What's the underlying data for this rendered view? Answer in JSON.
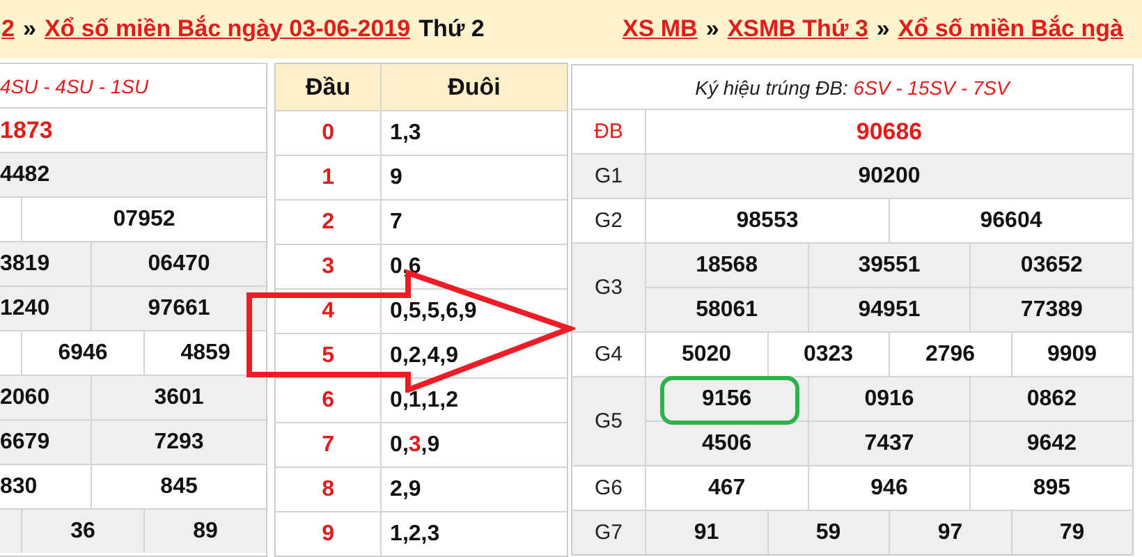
{
  "left": {
    "breadcrumb": [
      {
        "text": "2",
        "kind": "link"
      },
      {
        "text": "»",
        "kind": "sep"
      },
      {
        "text": "Xổ số miền Bắc ngày 03-06-2019",
        "kind": "link"
      },
      {
        "text": "Thứ 2",
        "kind": "plain"
      }
    ],
    "results": {
      "code": "4SU - 4SU - 1SU",
      "rows": [
        {
          "kind": "full",
          "shaded": false,
          "hot": true,
          "cells": [
            "1873"
          ]
        },
        {
          "kind": "full",
          "shaded": true,
          "hot": false,
          "cells": [
            "4482"
          ]
        },
        {
          "kind": "stub",
          "shaded": false,
          "hot": false,
          "cells": [
            "07952"
          ]
        },
        {
          "kind": "split",
          "shaded": true,
          "hot": false,
          "cells": [
            "3819",
            "06470"
          ]
        },
        {
          "kind": "split",
          "shaded": true,
          "hot": false,
          "cells": [
            "1240",
            "97661"
          ]
        },
        {
          "kind": "stub",
          "shaded": false,
          "hot": false,
          "cells": [
            "6946",
            "4859"
          ]
        },
        {
          "kind": "split",
          "shaded": true,
          "hot": false,
          "cells": [
            "2060",
            "3601"
          ]
        },
        {
          "kind": "split",
          "shaded": true,
          "hot": false,
          "cells": [
            "6679",
            "7293"
          ]
        },
        {
          "kind": "split",
          "shaded": false,
          "hot": false,
          "cells": [
            "830",
            "845"
          ]
        },
        {
          "kind": "stub",
          "shaded": true,
          "hot": false,
          "cells": [
            "36",
            "89"
          ]
        }
      ]
    },
    "head_tail": {
      "columns": [
        "Đầu",
        "Đuôi"
      ],
      "rows": [
        {
          "head": "0",
          "tail": [
            {
              "text": "1,3",
              "hot": false
            }
          ]
        },
        {
          "head": "1",
          "tail": [
            {
              "text": "9",
              "hot": false
            }
          ]
        },
        {
          "head": "2",
          "tail": [
            {
              "text": "7",
              "hot": false
            }
          ]
        },
        {
          "head": "3",
          "tail": [
            {
              "text": "0,6",
              "hot": false
            }
          ]
        },
        {
          "head": "4",
          "tail": [
            {
              "text": "0,5,5,6,9",
              "hot": false
            }
          ]
        },
        {
          "head": "5",
          "tail": [
            {
              "text": "0,2,4,9",
              "hot": false
            }
          ]
        },
        {
          "head": "6",
          "tail": [
            {
              "text": "0,1,1,2",
              "hot": false
            }
          ]
        },
        {
          "head": "7",
          "tail": [
            {
              "text": "0,",
              "hot": false
            },
            {
              "text": "3",
              "hot": true
            },
            {
              "text": ",9",
              "hot": false
            }
          ]
        },
        {
          "head": "8",
          "tail": [
            {
              "text": "2,9",
              "hot": false
            }
          ]
        },
        {
          "head": "9",
          "tail": [
            {
              "text": "1,2,3",
              "hot": false
            }
          ]
        }
      ]
    }
  },
  "right": {
    "breadcrumb": [
      {
        "text": "XS MB",
        "kind": "link"
      },
      {
        "text": "»",
        "kind": "sep"
      },
      {
        "text": "XSMB Thứ 3",
        "kind": "link"
      },
      {
        "text": "»",
        "kind": "sep"
      },
      {
        "text": "Xổ số miền Bắc ngà",
        "kind": "link"
      }
    ],
    "results": {
      "code_label": "Ký hiệu trúng ĐB:",
      "code": "6SV - 15SV - 7SV",
      "rows": [
        {
          "label": "ĐB",
          "hot": true,
          "shaded": false,
          "lines": [
            [
              {
                "text": "90686",
                "circled": false
              }
            ]
          ]
        },
        {
          "label": "G1",
          "hot": false,
          "shaded": true,
          "lines": [
            [
              {
                "text": "90200",
                "circled": false
              }
            ]
          ]
        },
        {
          "label": "G2",
          "hot": false,
          "shaded": false,
          "lines": [
            [
              {
                "text": "98553",
                "circled": false
              },
              {
                "text": "96604",
                "circled": false
              }
            ]
          ]
        },
        {
          "label": "G3",
          "hot": false,
          "shaded": true,
          "lines": [
            [
              {
                "text": "18568",
                "circled": false
              },
              {
                "text": "39551",
                "circled": false
              },
              {
                "text": "03652",
                "circled": false
              }
            ],
            [
              {
                "text": "58061",
                "circled": false
              },
              {
                "text": "94951",
                "circled": false
              },
              {
                "text": "77389",
                "circled": false
              }
            ]
          ]
        },
        {
          "label": "G4",
          "hot": false,
          "shaded": false,
          "lines": [
            [
              {
                "text": "5020",
                "circled": false
              },
              {
                "text": "0323",
                "circled": false
              },
              {
                "text": "2796",
                "circled": false
              },
              {
                "text": "9909",
                "circled": false
              }
            ]
          ]
        },
        {
          "label": "G5",
          "hot": false,
          "shaded": true,
          "lines": [
            [
              {
                "text": "9156",
                "circled": true
              },
              {
                "text": "0916",
                "circled": false
              },
              {
                "text": "0862",
                "circled": false
              }
            ],
            [
              {
                "text": "4506",
                "circled": false
              },
              {
                "text": "7437",
                "circled": false
              },
              {
                "text": "9642",
                "circled": false
              }
            ]
          ]
        },
        {
          "label": "G6",
          "hot": false,
          "shaded": false,
          "lines": [
            [
              {
                "text": "467",
                "circled": false
              },
              {
                "text": "946",
                "circled": false
              },
              {
                "text": "895",
                "circled": false
              }
            ]
          ]
        },
        {
          "label": "G7",
          "hot": false,
          "shaded": true,
          "lines": [
            [
              {
                "text": "91",
                "circled": false
              },
              {
                "text": "59",
                "circled": false
              },
              {
                "text": "97",
                "circled": false
              },
              {
                "text": "79",
                "circled": false
              }
            ]
          ]
        }
      ]
    }
  },
  "annotation": {
    "kind": "arrow"
  }
}
